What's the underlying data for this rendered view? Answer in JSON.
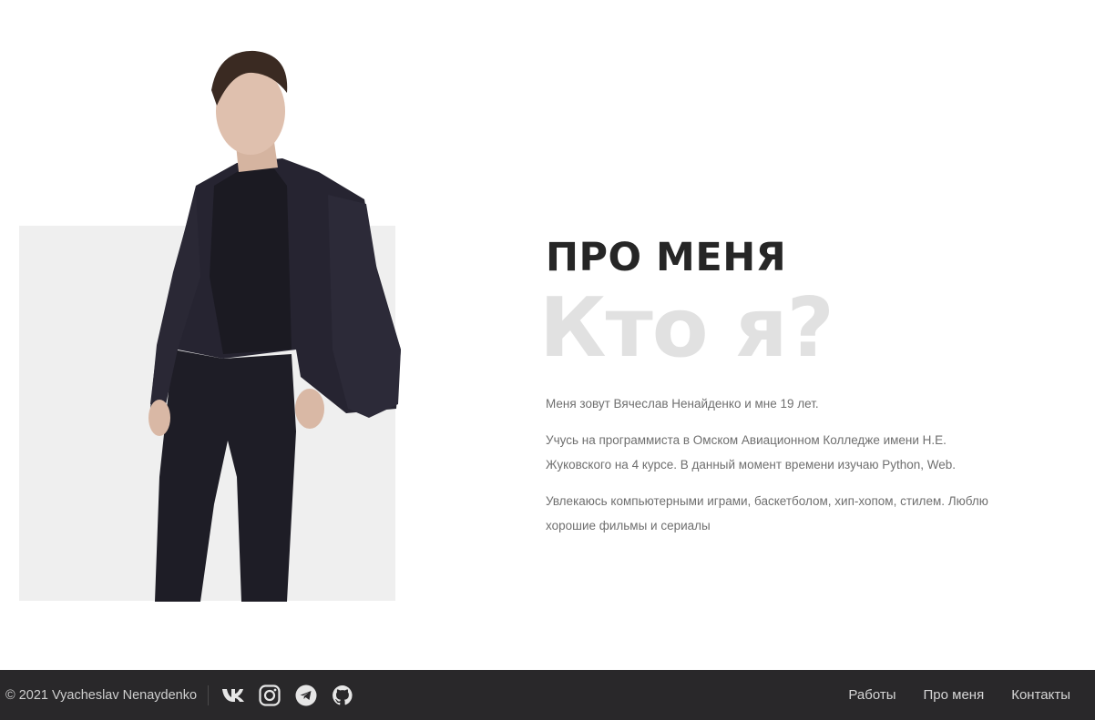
{
  "about": {
    "heading": "ПРО МЕНЯ",
    "ghost_heading": "Кто я?",
    "paragraphs": [
      "Меня зовут Вячеслав Ненайденко и мне 19 лет.",
      "Учусь на программиста в Омском Авиационном Колледже имени Н.Е. Жуковского на 4 курсе. В данный момент времени изучаю Python, Web.",
      "Увлекаюсь компьютерными играми, баскетболом, хип-хопом, стилем. Люблю хорошие фильмы и сериалы"
    ]
  },
  "footer": {
    "copyright": "© 2021 Vyacheslav Nenaydenko",
    "socials": [
      {
        "icon": "vk-icon"
      },
      {
        "icon": "instagram-icon"
      },
      {
        "icon": "telegram-icon"
      },
      {
        "icon": "github-icon"
      }
    ],
    "nav": [
      "Работы",
      "Про меня",
      "Контакты"
    ]
  },
  "colors": {
    "footer_bg": "#29282a",
    "photo_bg": "#efefef",
    "ghost_text": "#e1e1e1",
    "heading": "#262626",
    "body_text": "#6f6f6f"
  }
}
